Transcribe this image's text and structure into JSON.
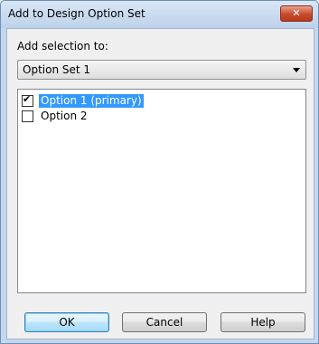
{
  "window": {
    "title": "Add to Design Option Set"
  },
  "dialog": {
    "prompt_label": "Add selection to:",
    "combo": {
      "selected": "Option Set 1"
    },
    "options": [
      {
        "label": "Option 1 (primary)",
        "checked": true,
        "selected": true
      },
      {
        "label": "Option 2",
        "checked": false,
        "selected": false
      }
    ],
    "buttons": {
      "ok": "OK",
      "cancel": "Cancel",
      "help": "Help"
    }
  },
  "colors": {
    "selection": "#3399ff",
    "close_button": "#c74a2c"
  },
  "glyphs": {
    "close": "✕",
    "check": "✔"
  }
}
